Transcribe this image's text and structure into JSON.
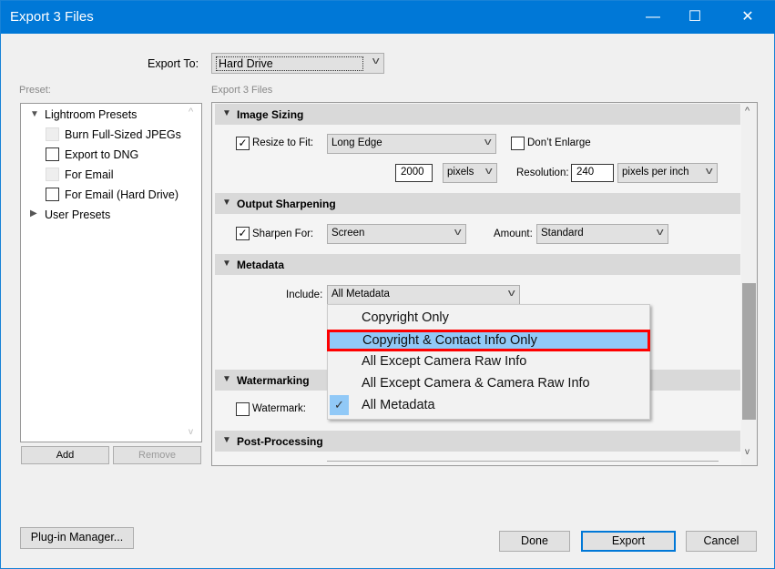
{
  "window": {
    "title": "Export 3 Files",
    "minimize": "—",
    "maximize": "☐",
    "close": "✕"
  },
  "export_to": {
    "label": "Export To:",
    "value": "Hard Drive"
  },
  "preset": {
    "label": "Preset:",
    "groups": [
      {
        "label": "Lightroom Presets",
        "expanded": true,
        "items": [
          {
            "label": "Burn Full-Sized JPEGs",
            "enabled": false
          },
          {
            "label": "Export to DNG",
            "enabled": true
          },
          {
            "label": "For Email",
            "enabled": false
          },
          {
            "label": "For Email (Hard Drive)",
            "enabled": true
          }
        ]
      },
      {
        "label": "User Presets",
        "expanded": false
      }
    ],
    "add": "Add",
    "remove": "Remove"
  },
  "panel_title": "Export 3 Files",
  "image_sizing": {
    "title": "Image Sizing",
    "resize_label": "Resize to Fit:",
    "resize_checked": true,
    "resize_mode": "Long Edge",
    "dont_enlarge": "Don’t Enlarge",
    "size_value": "2000",
    "size_unit": "pixels",
    "resolution_label": "Resolution:",
    "resolution_value": "240",
    "resolution_unit": "pixels per inch"
  },
  "output_sharpening": {
    "title": "Output Sharpening",
    "sharpen_label": "Sharpen For:",
    "sharpen_for": "Screen",
    "amount_label": "Amount:",
    "amount": "Standard"
  },
  "metadata": {
    "title": "Metadata",
    "include_label": "Include:",
    "include_value": "All Metadata",
    "options": [
      "Copyright Only",
      "Copyright & Contact Info Only",
      "All Except Camera Raw Info",
      "All Except Camera & Camera Raw Info",
      "All Metadata"
    ],
    "highlighted": "Copyright & Contact Info Only",
    "checked": "All Metadata"
  },
  "watermarking": {
    "title": "Watermarking",
    "label": "Watermark:"
  },
  "post_processing": {
    "title": "Post-Processing"
  },
  "buttons": {
    "plugin": "Plug-in Manager...",
    "done": "Done",
    "export": "Export",
    "cancel": "Cancel"
  }
}
